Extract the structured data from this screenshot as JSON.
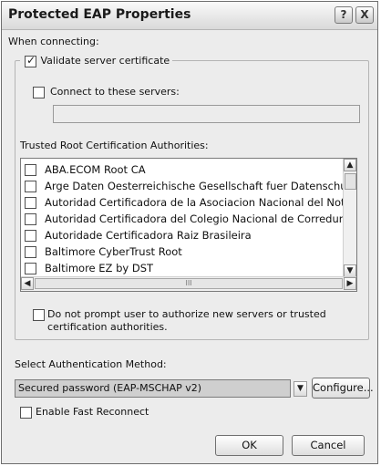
{
  "window": {
    "title": "Protected EAP Properties",
    "help_glyph": "?",
    "close_glyph": "X"
  },
  "when_connecting": "When connecting:",
  "validate_cert": {
    "label": "Validate server certificate",
    "checked": true
  },
  "connect_servers": {
    "label": "Connect to these servers:",
    "checked": false,
    "value": ""
  },
  "trusted_root_label": "Trusted Root Certification Authorities:",
  "cert_list": [
    {
      "name": "ABA.ECOM Root CA",
      "checked": false
    },
    {
      "name": "Arge Daten Oesterreichische Gesellschaft fuer Datenschutz",
      "checked": false
    },
    {
      "name": "Autoridad Certificadora de la Asociacion Nacional del Notaria",
      "checked": false
    },
    {
      "name": "Autoridad Certificadora del Colegio Nacional de Correduria P",
      "checked": false
    },
    {
      "name": "Autoridade Certificadora Raiz Brasileira",
      "checked": false
    },
    {
      "name": "Baltimore CyberTrust Root",
      "checked": false
    },
    {
      "name": "Baltimore EZ by DST",
      "checked": false
    }
  ],
  "scroll_thumb_glyph": "III",
  "do_not_prompt": {
    "line1": "Do not prompt user to authorize new servers or trusted",
    "line2": "certification authorities.",
    "checked": false
  },
  "auth_method_label": "Select Authentication Method:",
  "auth_method_value": "Secured password (EAP-MSCHAP v2)",
  "configure_label": "Configure...",
  "fast_reconnect": {
    "label": "Enable Fast Reconnect",
    "checked": false
  },
  "ok_label": "OK",
  "cancel_label": "Cancel"
}
